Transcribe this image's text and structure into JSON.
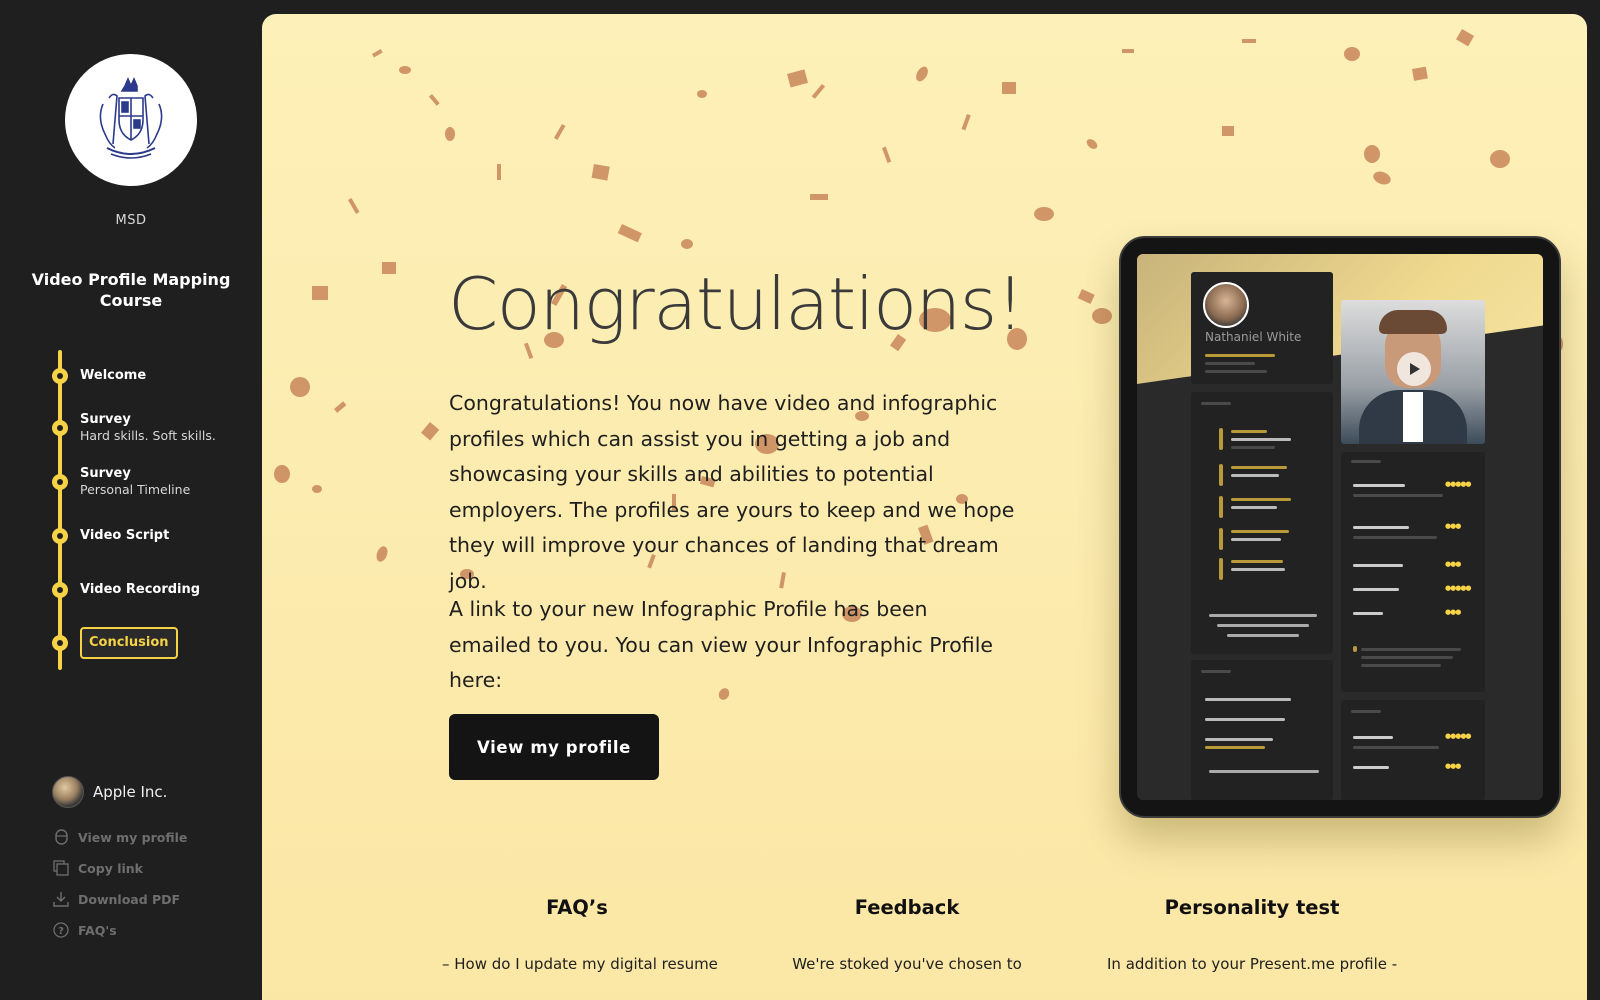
{
  "sidebar": {
    "org_name": "MSD",
    "logo_icon": "coat-of-arms-icon",
    "course_title": "Video Profile Mapping Course",
    "steps": [
      {
        "label": "Welcome",
        "sub": ""
      },
      {
        "label": "Survey",
        "sub": "Hard skills. Soft skills."
      },
      {
        "label": "Survey",
        "sub": "Personal Timeline"
      },
      {
        "label": "Video Script",
        "sub": ""
      },
      {
        "label": "Video Recording",
        "sub": ""
      },
      {
        "label": "Conclusion",
        "sub": "",
        "active": true
      }
    ],
    "company": "Apple Inc.",
    "links": [
      {
        "label": "View my profile",
        "icon": "mouse-icon"
      },
      {
        "label": "Copy link",
        "icon": "copy-icon"
      },
      {
        "label": "Download PDF",
        "icon": "download-icon"
      },
      {
        "label": "FAQ's",
        "icon": "question-icon"
      }
    ]
  },
  "main": {
    "title": "Congratulations!",
    "paragraph1": "Congratulations! You now have video and infographic profiles which can assist you in getting a job and showcasing your skills and abilities to potential employers. The profiles are yours to keep and we hope they will improve your chances of landing that dream job.",
    "paragraph2": "A link to your new Infographic Profile has been emailed to you. You can view your Infographic Profile here:",
    "cta_label": "View my profile",
    "preview": {
      "name": "Nathaniel White",
      "play_icon": "play-icon"
    },
    "columns": [
      {
        "title": "FAQ’s",
        "text": "– How do I update my digital resume"
      },
      {
        "title": "Feedback",
        "text": "We're stoked you've chosen to"
      },
      {
        "title": "Personality test",
        "text": "In addition to your Present.me profile -"
      }
    ]
  },
  "colors": {
    "sidebar_bg": "#1f1f1f",
    "accent": "#f5d246",
    "main_bg": "#fdf0b8",
    "confetti": "#c8865a",
    "button_bg": "#141414"
  }
}
